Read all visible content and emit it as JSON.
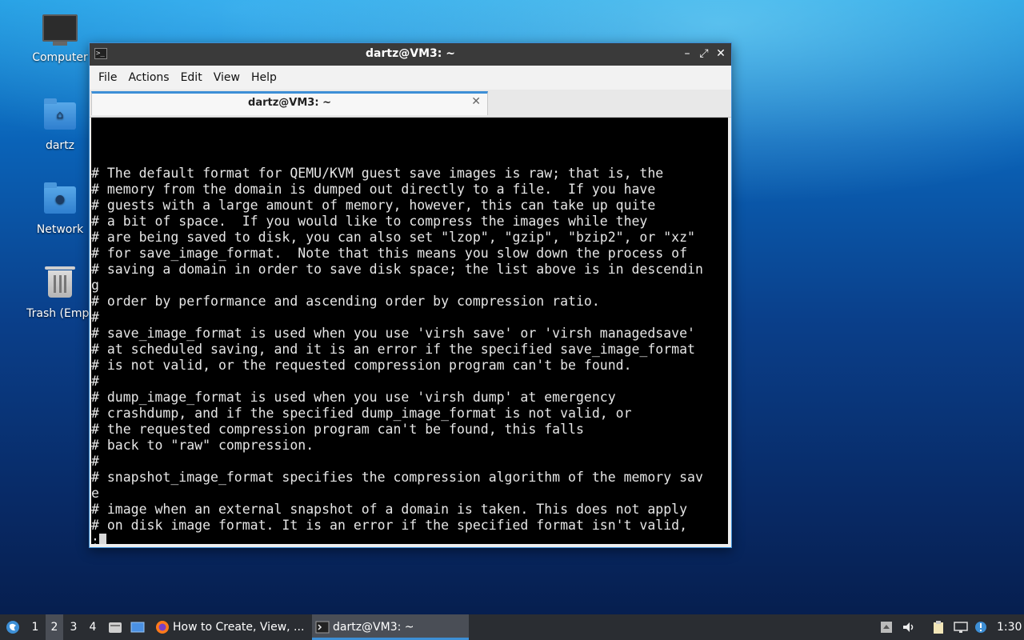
{
  "desktop": {
    "icons": [
      {
        "label": "Computer",
        "icon": "computer-icon"
      },
      {
        "label": "dartz",
        "icon": "home-folder-icon"
      },
      {
        "label": "Network",
        "icon": "network-folder-icon"
      },
      {
        "label": "Trash (Empt",
        "icon": "trash-icon"
      }
    ]
  },
  "window": {
    "title": "dartz@VM3: ~",
    "controls": {
      "minimize": "–",
      "maximize": "⤢",
      "close": "✕"
    },
    "menu": [
      "File",
      "Actions",
      "Edit",
      "View",
      "Help"
    ],
    "tab": {
      "label": "dartz@VM3: ~",
      "close": "✕"
    },
    "terminal": {
      "lines": [
        "",
        "# The default format for QEMU/KVM guest save images is raw; that is, the",
        "# memory from the domain is dumped out directly to a file.  If you have",
        "# guests with a large amount of memory, however, this can take up quite",
        "# a bit of space.  If you would like to compress the images while they",
        "# are being saved to disk, you can also set \"lzop\", \"gzip\", \"bzip2\", or \"xz\"",
        "# for save_image_format.  Note that this means you slow down the process of",
        "# saving a domain in order to save disk space; the list above is in descendin",
        "g",
        "# order by performance and ascending order by compression ratio.",
        "#",
        "# save_image_format is used when you use 'virsh save' or 'virsh managedsave'",
        "# at scheduled saving, and it is an error if the specified save_image_format",
        "# is not valid, or the requested compression program can't be found.",
        "#",
        "# dump_image_format is used when you use 'virsh dump' at emergency",
        "# crashdump, and if the specified dump_image_format is not valid, or",
        "# the requested compression program can't be found, this falls",
        "# back to \"raw\" compression.",
        "#",
        "# snapshot_image_format specifies the compression algorithm of the memory sav",
        "e",
        "# image when an external snapshot of a domain is taken. This does not apply",
        "# on disk image format. It is an error if the specified format isn't valid,"
      ],
      "prompt": ":"
    }
  },
  "taskbar": {
    "workspaces": [
      "1",
      "2",
      "3",
      "4"
    ],
    "active_workspace": "2",
    "tasks": [
      {
        "label": "How to Create, View, ...",
        "icon": "firefox-icon"
      },
      {
        "label": "dartz@VM3: ~",
        "icon": "terminal-icon"
      }
    ],
    "clock": "1:30"
  }
}
